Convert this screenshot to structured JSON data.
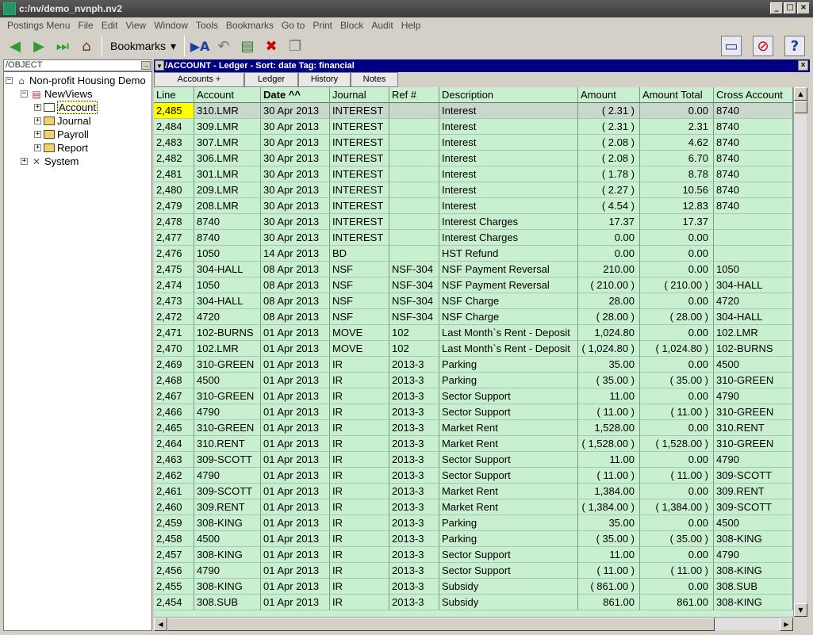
{
  "window": {
    "title": "c:/nv/demo_nvnph.nv2"
  },
  "menu": [
    "Postings Menu",
    "File",
    "Edit",
    "View",
    "Window",
    "Tools",
    "Bookmarks",
    "Go to",
    "Print",
    "Block",
    "Audit",
    "Help"
  ],
  "toolbar": {
    "bookmarks_label": "Bookmarks",
    "bookmarks_arrow": "▾"
  },
  "left_panel": {
    "header": "/OBJECT",
    "tree": [
      {
        "label": "Non-profit Housing Demo",
        "expander": "−",
        "icon": "home-icon"
      },
      {
        "label": "NewViews",
        "expander": "−",
        "icon": "books-icon"
      },
      {
        "label": "Account",
        "expander": "+",
        "icon": "folder-open-icon",
        "selected": true
      },
      {
        "label": "Journal",
        "expander": "+",
        "icon": "folder-icon"
      },
      {
        "label": "Payroll",
        "expander": "+",
        "icon": "folder-icon"
      },
      {
        "label": "Report",
        "expander": "+",
        "icon": "folder-icon"
      },
      {
        "label": "System",
        "expander": "+",
        "icon": "tools-icon"
      }
    ]
  },
  "right_panel": {
    "header": "/ACCOUNT - Ledger - Sort: date  Tag: financial",
    "tabs": [
      "Accounts     +",
      "Ledger",
      "History",
      "Notes"
    ],
    "columns": [
      "Line",
      "Account",
      "Date  ^^",
      "Journal",
      "Ref #",
      "Description",
      "Amount",
      "Amount Total",
      "Cross Account"
    ],
    "rows": [
      [
        "2,485",
        "310.LMR",
        "30 Apr 2013",
        "INTEREST",
        "",
        "Interest",
        "( 2.31 )",
        "0.00",
        "8740"
      ],
      [
        "2,484",
        "309.LMR",
        "30 Apr 2013",
        "INTEREST",
        "",
        "Interest",
        "( 2.31 )",
        "2.31",
        "8740"
      ],
      [
        "2,483",
        "307.LMR",
        "30 Apr 2013",
        "INTEREST",
        "",
        "Interest",
        "( 2.08 )",
        "4.62",
        "8740"
      ],
      [
        "2,482",
        "306.LMR",
        "30 Apr 2013",
        "INTEREST",
        "",
        "Interest",
        "( 2.08 )",
        "6.70",
        "8740"
      ],
      [
        "2,481",
        "301.LMR",
        "30 Apr 2013",
        "INTEREST",
        "",
        "Interest",
        "( 1.78 )",
        "8.78",
        "8740"
      ],
      [
        "2,480",
        "209.LMR",
        "30 Apr 2013",
        "INTEREST",
        "",
        "Interest",
        "( 2.27 )",
        "10.56",
        "8740"
      ],
      [
        "2,479",
        "208.LMR",
        "30 Apr 2013",
        "INTEREST",
        "",
        "Interest",
        "( 4.54 )",
        "12.83",
        "8740"
      ],
      [
        "2,478",
        "8740",
        "30 Apr 2013",
        "INTEREST",
        "",
        "Interest Charges",
        "17.37",
        "17.37",
        ""
      ],
      [
        "2,477",
        "8740",
        "30 Apr 2013",
        "INTEREST",
        "",
        "Interest Charges",
        "0.00",
        "0.00",
        ""
      ],
      [
        "2,476",
        "1050",
        "14 Apr 2013",
        "BD",
        "",
        "HST Refund",
        "0.00",
        "0.00",
        ""
      ],
      [
        "2,475",
        "304-HALL",
        "08 Apr 2013",
        "NSF",
        "NSF-304",
        "NSF Payment Reversal",
        "210.00",
        "0.00",
        "1050"
      ],
      [
        "2,474",
        "1050",
        "08 Apr 2013",
        "NSF",
        "NSF-304",
        "NSF Payment Reversal",
        "( 210.00 )",
        "( 210.00 )",
        "304-HALL"
      ],
      [
        "2,473",
        "304-HALL",
        "08 Apr 2013",
        "NSF",
        "NSF-304",
        "NSF Charge",
        "28.00",
        "0.00",
        "4720"
      ],
      [
        "2,472",
        "4720",
        "08 Apr 2013",
        "NSF",
        "NSF-304",
        "NSF Charge",
        "( 28.00 )",
        "( 28.00 )",
        "304-HALL"
      ],
      [
        "2,471",
        "102-BURNS",
        "01 Apr 2013",
        "MOVE",
        "102",
        "Last Month`s Rent - Deposit",
        "1,024.80",
        "0.00",
        "102.LMR"
      ],
      [
        "2,470",
        "102.LMR",
        "01 Apr 2013",
        "MOVE",
        "102",
        "Last Month`s Rent - Deposit",
        "( 1,024.80 )",
        "( 1,024.80 )",
        "102-BURNS"
      ],
      [
        "2,469",
        "310-GREEN",
        "01 Apr 2013",
        "IR",
        "2013-3",
        "Parking",
        "35.00",
        "0.00",
        "4500"
      ],
      [
        "2,468",
        "4500",
        "01 Apr 2013",
        "IR",
        "2013-3",
        "Parking",
        "( 35.00 )",
        "( 35.00 )",
        "310-GREEN"
      ],
      [
        "2,467",
        "310-GREEN",
        "01 Apr 2013",
        "IR",
        "2013-3",
        "Sector Support",
        "11.00",
        "0.00",
        "4790"
      ],
      [
        "2,466",
        "4790",
        "01 Apr 2013",
        "IR",
        "2013-3",
        "Sector Support",
        "( 11.00 )",
        "( 11.00 )",
        "310-GREEN"
      ],
      [
        "2,465",
        "310-GREEN",
        "01 Apr 2013",
        "IR",
        "2013-3",
        "Market Rent",
        "1,528.00",
        "0.00",
        "310.RENT"
      ],
      [
        "2,464",
        "310.RENT",
        "01 Apr 2013",
        "IR",
        "2013-3",
        "Market Rent",
        "( 1,528.00 )",
        "( 1,528.00 )",
        "310-GREEN"
      ],
      [
        "2,463",
        "309-SCOTT",
        "01 Apr 2013",
        "IR",
        "2013-3",
        "Sector Support",
        "11.00",
        "0.00",
        "4790"
      ],
      [
        "2,462",
        "4790",
        "01 Apr 2013",
        "IR",
        "2013-3",
        "Sector Support",
        "( 11.00 )",
        "( 11.00 )",
        "309-SCOTT"
      ],
      [
        "2,461",
        "309-SCOTT",
        "01 Apr 2013",
        "IR",
        "2013-3",
        "Market Rent",
        "1,384.00",
        "0.00",
        "309.RENT"
      ],
      [
        "2,460",
        "309.RENT",
        "01 Apr 2013",
        "IR",
        "2013-3",
        "Market Rent",
        "( 1,384.00 )",
        "( 1,384.00 )",
        "309-SCOTT"
      ],
      [
        "2,459",
        "308-KING",
        "01 Apr 2013",
        "IR",
        "2013-3",
        "Parking",
        "35.00",
        "0.00",
        "4500"
      ],
      [
        "2,458",
        "4500",
        "01 Apr 2013",
        "IR",
        "2013-3",
        "Parking",
        "( 35.00 )",
        "( 35.00 )",
        "308-KING"
      ],
      [
        "2,457",
        "308-KING",
        "01 Apr 2013",
        "IR",
        "2013-3",
        "Sector Support",
        "11.00",
        "0.00",
        "4790"
      ],
      [
        "2,456",
        "4790",
        "01 Apr 2013",
        "IR",
        "2013-3",
        "Sector Support",
        "( 11.00 )",
        "( 11.00 )",
        "308-KING"
      ],
      [
        "2,455",
        "308-KING",
        "01 Apr 2013",
        "IR",
        "2013-3",
        "Subsidy",
        "( 861.00 )",
        "0.00",
        "308.SUB"
      ],
      [
        "2,454",
        "308.SUB",
        "01 Apr 2013",
        "IR",
        "2013-3",
        "Subsidy",
        "861.00",
        "861.00",
        "308-KING"
      ]
    ]
  }
}
